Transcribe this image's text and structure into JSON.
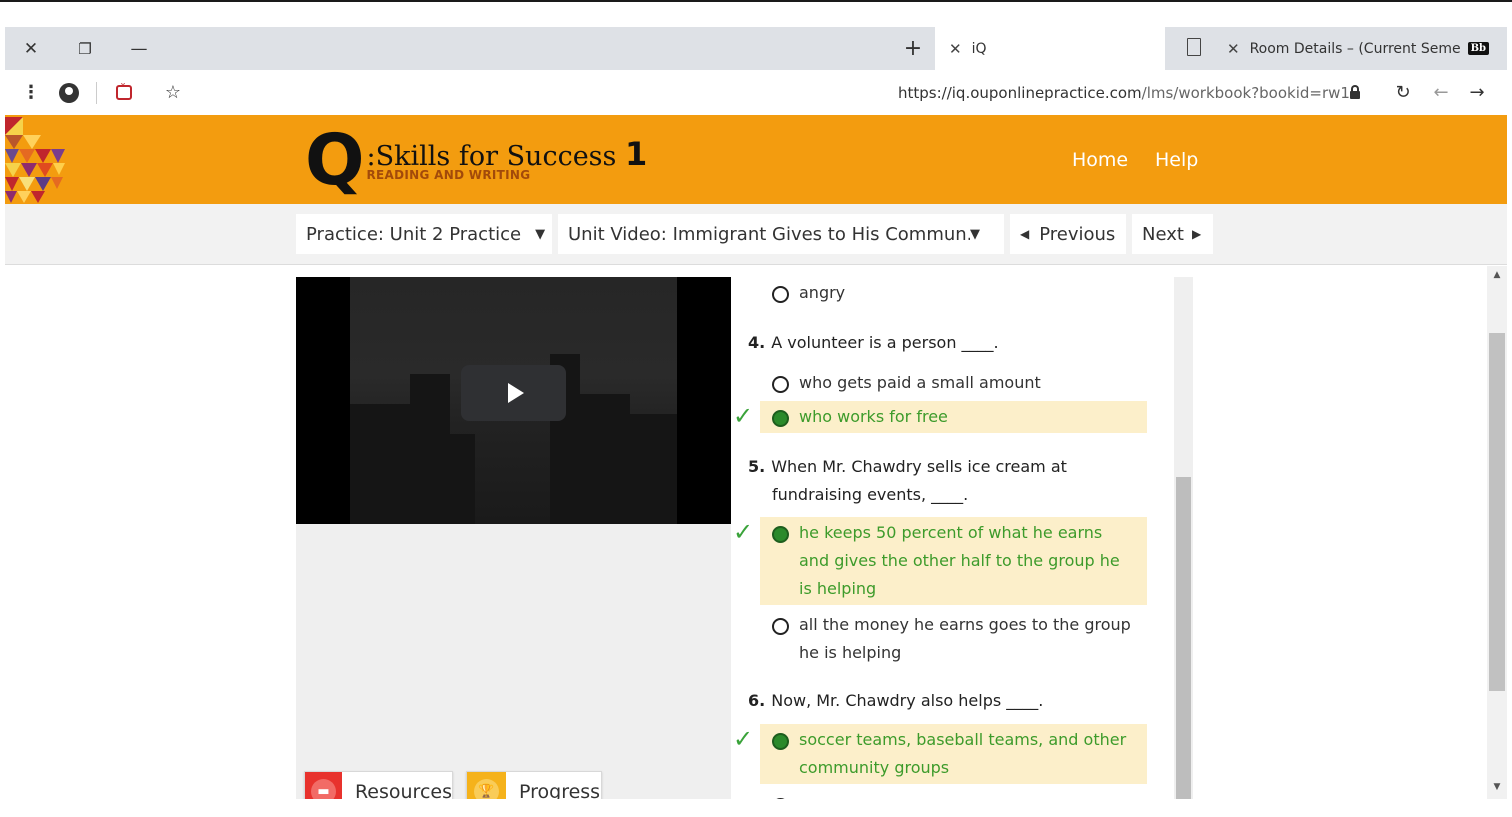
{
  "browser": {
    "tabs": [
      {
        "title": "iQ",
        "active": true
      },
      {
        "title": "Room Details – (Current Semeste",
        "badge": "Bb",
        "active": false
      }
    ],
    "url": {
      "host": "https://iq.ouponlinepractice.com",
      "path": "/lms/workbook?bookid=rw1"
    },
    "icons": [
      "close-icon",
      "restore-icon",
      "minimize-icon",
      "new-tab-icon",
      "menu-icon",
      "profile-icon",
      "pocket-icon",
      "star-icon",
      "lock-icon",
      "reload-icon",
      "back-icon",
      "forward-icon"
    ]
  },
  "header": {
    "logo": {
      "letter": "Q",
      "colon": ":",
      "title": "Skills for Success",
      "level": "1",
      "subtitle": "READING AND WRITING"
    },
    "nav": [
      {
        "label": "Home"
      },
      {
        "label": "Help"
      }
    ],
    "colors": {
      "bar": "#f39c0f",
      "nav_text": "#ffffff"
    }
  },
  "toolbar": {
    "practice_select": "Practice: Unit 2 Practice",
    "activity_select": "Unit Video: Immigrant Gives to His Commun...",
    "previous_label": "Previous",
    "next_label": "Next"
  },
  "quiz": {
    "partial_top_option": {
      "text": "angry",
      "selected": false
    },
    "questions": [
      {
        "number": "4.",
        "text": "A volunteer is a person ____.",
        "options": [
          {
            "text": "who gets paid a small amount",
            "selected": false,
            "correct": false
          },
          {
            "text": "who works for free",
            "selected": true,
            "correct": true
          }
        ]
      },
      {
        "number": "5.",
        "text": "When Mr. Chawdry sells ice cream at fundraising events, ____.",
        "options": [
          {
            "text": "he keeps 50 percent of what he earns and gives the other half to the group he is helping",
            "selected": true,
            "correct": true
          },
          {
            "text": "all the money he earns goes to the group he is helping",
            "selected": false,
            "correct": false
          }
        ]
      },
      {
        "number": "6.",
        "text": "Now, Mr. Chawdry also helps ____.",
        "options": [
          {
            "text": "soccer teams, baseball teams, and other community groups",
            "selected": true,
            "correct": true
          }
        ]
      }
    ],
    "colors": {
      "correct_bg": "#fcefca",
      "correct_text": "#3d9b2b",
      "check": "#3aa33a"
    }
  },
  "footer_buttons": [
    {
      "label": "Resources",
      "icon": "folder-icon",
      "color": "#e8322d"
    },
    {
      "label": "Progress",
      "icon": "trophy-icon",
      "color": "#f5b21b"
    }
  ]
}
